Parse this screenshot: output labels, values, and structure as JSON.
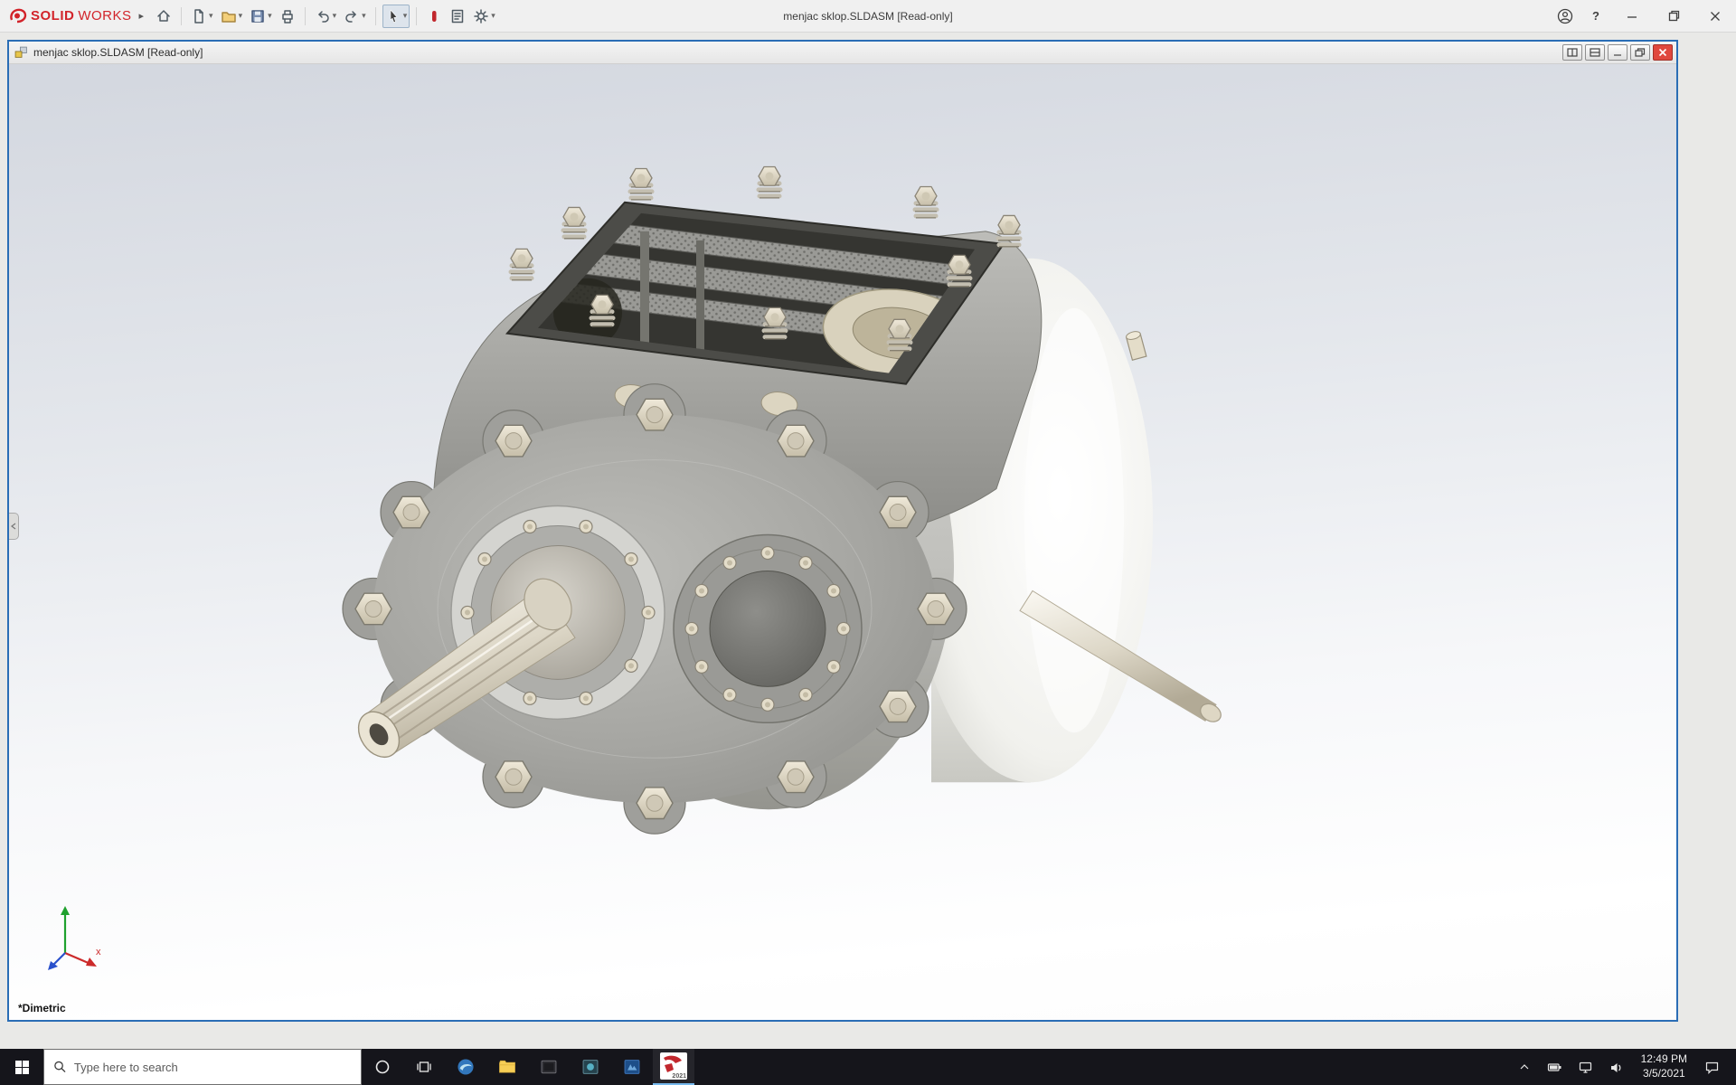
{
  "colors": {
    "accent_window_border": "#2a6db5",
    "logo_red": "#d2232a",
    "taskbar_bg": "#15151b",
    "viewport_gradient_top": "#d3d7df",
    "close_button_red": "#e0483e"
  },
  "app_titlebar": {
    "logo_bold": "SOLID",
    "logo_light": "WORKS",
    "expand_arrow": "▸",
    "title": "menjac sklop.SLDASM [Read-only]",
    "help_glyph": "?"
  },
  "toolbar": {
    "caret": "▾"
  },
  "document_window": {
    "title": "menjac sklop.SLDASM [Read-only]"
  },
  "viewport": {
    "orientation_label": "*Dimetric",
    "triad_x_label": "x"
  },
  "taskbar": {
    "search_placeholder": "Type here to search",
    "solidworks_badge": "2021",
    "clock_time": "12:49 PM",
    "clock_date": "3/5/2021"
  }
}
